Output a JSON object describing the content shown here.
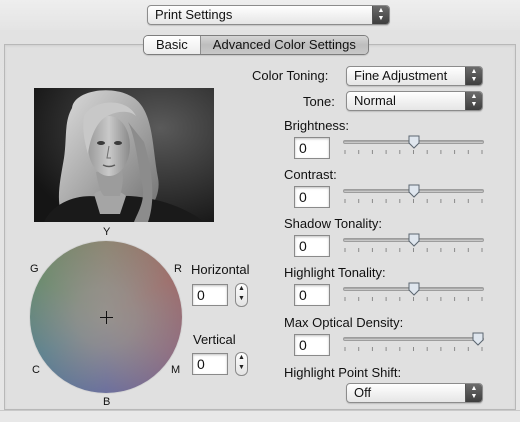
{
  "header": {
    "popup_label": "Print Settings"
  },
  "tabs": [
    {
      "label": "Basic",
      "active": false
    },
    {
      "label": "Advanced Color Settings",
      "active": true
    }
  ],
  "controls": {
    "color_toning": {
      "label": "Color Toning:",
      "value": "Fine Adjustment"
    },
    "tone": {
      "label": "Tone:",
      "value": "Normal"
    },
    "sliders": [
      {
        "label": "Brightness:",
        "value": "0",
        "position": 0.5
      },
      {
        "label": "Contrast:",
        "value": "0",
        "position": 0.5
      },
      {
        "label": "Shadow Tonality:",
        "value": "0",
        "position": 0.5
      },
      {
        "label": "Highlight Tonality:",
        "value": "0",
        "position": 0.5
      },
      {
        "label": "Max Optical Density:",
        "value": "0",
        "position": 1.0
      }
    ],
    "highlight_point_shift": {
      "label": "Highlight Point Shift:",
      "value": "Off"
    }
  },
  "color_circle": {
    "labels": {
      "Y": "Y",
      "R": "R",
      "M": "M",
      "B": "B",
      "C": "C",
      "G": "G"
    },
    "horizontal": {
      "label": "Horizontal",
      "value": "0"
    },
    "vertical": {
      "label": "Vertical",
      "value": "0"
    }
  },
  "icons": {
    "popup_arrows": "up-down-arrows-icon",
    "stepper": "stepper-icon",
    "crosshair": "crosshair-icon",
    "photo": "preview-photo"
  },
  "colors": {
    "accent_dark": "#3e3e3e",
    "panel_bg": "#e0e0e0"
  }
}
